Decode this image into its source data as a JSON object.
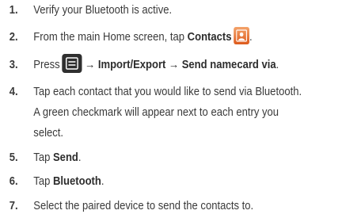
{
  "steps": [
    {
      "num": "1.",
      "lines": [
        "Verify your Bluetooth is active."
      ]
    },
    {
      "num": "2.",
      "pre": "From the main Home screen, tap ",
      "bold": "Contacts",
      "post": "."
    },
    {
      "num": "3.",
      "pre": "Press",
      "bold": "→ Import/Export → Send namecard via",
      "post": "."
    },
    {
      "num": "4.",
      "lines": [
        "Tap each contact that you would like to send via Bluetooth.",
        "A green checkmark will appear next to each entry you",
        "select."
      ]
    },
    {
      "num": "5.",
      "pre": "Tap ",
      "bold": "Send",
      "post": "."
    },
    {
      "num": "6.",
      "pre": "Tap ",
      "bold": "Bluetooth",
      "post": "."
    },
    {
      "num": "7.",
      "lines": [
        "Select the paired device to send the contacts to."
      ]
    }
  ],
  "icons": {
    "contacts": "contacts-app-icon",
    "menu": "menu-key-icon"
  }
}
